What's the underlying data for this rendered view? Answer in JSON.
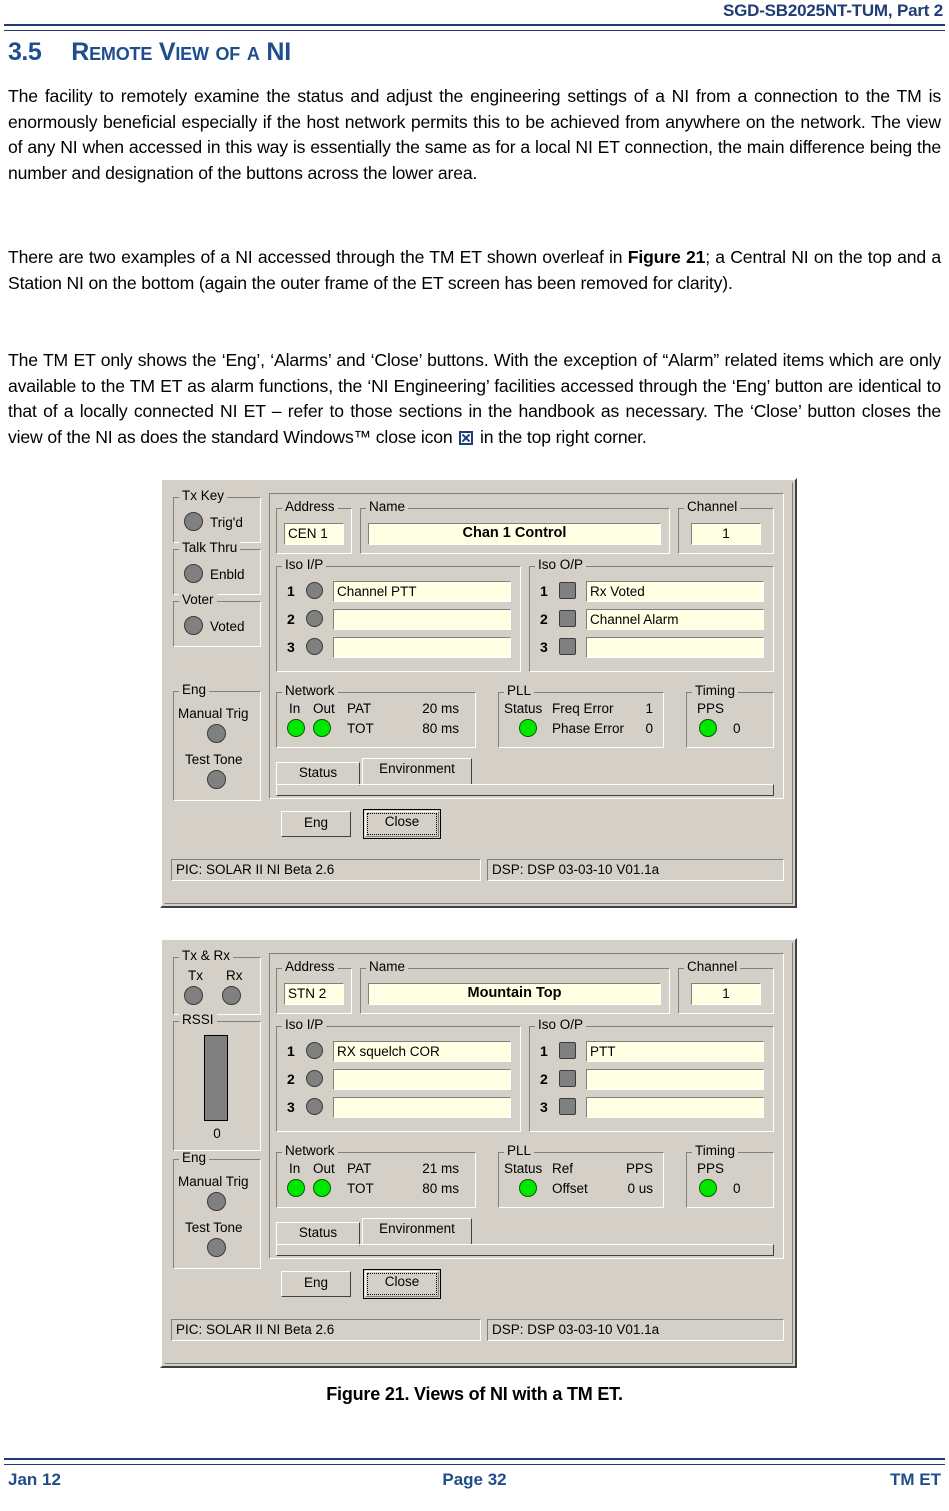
{
  "header": {
    "doc_ref": "SGD-SB2025NT-TUM, Part 2"
  },
  "section": {
    "number": "3.5",
    "title": "Remote View of a NI"
  },
  "paragraphs": {
    "p1": "The facility to remotely examine the status and adjust the engineering settings of a NI from a connection to the TM is enormously beneficial especially if the host network permits this to be achieved from anywhere on the network.  The view of any NI when accessed in this way is essentially the same as for a local NI ET connection, the main difference being the number and designation of the buttons across the lower area.",
    "p2_part1": "There are two examples of a NI accessed through the TM ET shown overleaf in ",
    "p2_bold": "Figure 21",
    "p2_part2": "; a Central NI on the top and a Station NI on the bottom (again the outer frame of the ET screen has been removed for clarity).",
    "p3_part1": "The TM ET only shows the ‘Eng’, ‘Alarms’ and ‘Close’ buttons.  With the exception of “Alarm” related items which are only available to the TM ET as alarm functions, the ‘NI Engineering’ facilities accessed through the ‘Eng’ button are identical to that of a locally connected NI ET – refer to those sections in the handbook as necessary.  The ‘Close’ button closes the view of the NI as does the standard Windows™ close icon ",
    "p3_part2": " in the top right corner.",
    "close_icon_name": "window-close-icon"
  },
  "figure": {
    "caption": "Figure 21.  Views of NI with a TM ET."
  },
  "footer": {
    "left": "Jan 12",
    "center": "Page 32",
    "right": "TM ET"
  },
  "colors": {
    "heading_blue": "#1F4E8C",
    "header_blue": "#1F3C76",
    "dialog_face": "#d4d0c8",
    "field_cream": "#ffffe4",
    "led_on": "#00e800",
    "led_off": "#808080"
  },
  "dialogs": [
    {
      "id": "central-ni",
      "left_groups": {
        "tx_key": {
          "label": "Tx Key",
          "led_label": "Trig'd",
          "led_state": "off"
        },
        "talk_thru": {
          "label": "Talk Thru",
          "led_label": "Enbld",
          "led_state": "off"
        },
        "voter": {
          "label": "Voter",
          "led_label": "Voted",
          "led_state": "off"
        },
        "eng": {
          "label": "Eng",
          "manual_trig_label": "Manual Trig",
          "manual_trig_state": "off",
          "test_tone_label": "Test Tone",
          "test_tone_state": "off"
        }
      },
      "address": {
        "label": "Address",
        "value": "CEN 1"
      },
      "name": {
        "label": "Name",
        "value": "Chan 1 Control"
      },
      "channel": {
        "label": "Channel",
        "value": "1"
      },
      "iso_ip": {
        "label": "Iso I/P",
        "rows": [
          {
            "num": "1",
            "led_state": "off",
            "value": "Channel PTT"
          },
          {
            "num": "2",
            "led_state": "off",
            "value": ""
          },
          {
            "num": "3",
            "led_state": "off",
            "value": ""
          }
        ]
      },
      "iso_op": {
        "label": "Iso O/P",
        "rows": [
          {
            "num": "1",
            "led_state": "off",
            "value": "Rx Voted"
          },
          {
            "num": "2",
            "led_state": "off",
            "value": "Channel Alarm"
          },
          {
            "num": "3",
            "led_state": "off",
            "value": ""
          }
        ]
      },
      "network": {
        "label": "Network",
        "in_label": "In",
        "out_label": "Out",
        "in_state": "on",
        "out_state": "on",
        "pat_label": "PAT",
        "pat_value": "20 ms",
        "tot_label": "TOT",
        "tot_value": "80 ms"
      },
      "pll": {
        "label": "PLL",
        "status_label": "Status",
        "status_state": "on",
        "row1_label": "Freq Error",
        "row1_value": "1",
        "row2_label": "Phase Error",
        "row2_value": "0"
      },
      "timing": {
        "label": "Timing",
        "pps_label": "PPS",
        "pps_state": "on",
        "pps_value": "0"
      },
      "tabs": [
        {
          "label": "Status",
          "active": true
        },
        {
          "label": "Environment",
          "active": false
        }
      ],
      "buttons": [
        {
          "label": "Eng",
          "default": false
        },
        {
          "label": "Close",
          "default": true
        }
      ],
      "status_bar": [
        "PIC: SOLAR II NI Beta 2.6",
        "DSP: DSP 03-03-10 V01.1a"
      ]
    },
    {
      "id": "station-ni",
      "left_groups": {
        "tx_rx": {
          "label": "Tx & Rx",
          "tx_label": "Tx",
          "rx_label": "Rx",
          "tx_state": "off",
          "rx_state": "off"
        },
        "rssi": {
          "label": "RSSI",
          "value": "0",
          "bar_fill_percent": 100
        },
        "eng": {
          "label": "Eng",
          "manual_trig_label": "Manual Trig",
          "manual_trig_state": "off",
          "test_tone_label": "Test Tone",
          "test_tone_state": "off"
        }
      },
      "address": {
        "label": "Address",
        "value": "STN 2"
      },
      "name": {
        "label": "Name",
        "value": "Mountain Top"
      },
      "channel": {
        "label": "Channel",
        "value": "1"
      },
      "iso_ip": {
        "label": "Iso I/P",
        "rows": [
          {
            "num": "1",
            "led_state": "off",
            "value": "RX squelch COR"
          },
          {
            "num": "2",
            "led_state": "off",
            "value": ""
          },
          {
            "num": "3",
            "led_state": "off",
            "value": ""
          }
        ]
      },
      "iso_op": {
        "label": "Iso O/P",
        "rows": [
          {
            "num": "1",
            "led_state": "off",
            "value": "PTT"
          },
          {
            "num": "2",
            "led_state": "off",
            "value": ""
          },
          {
            "num": "3",
            "led_state": "off",
            "value": ""
          }
        ]
      },
      "network": {
        "label": "Network",
        "in_label": "In",
        "out_label": "Out",
        "in_state": "on",
        "out_state": "on",
        "pat_label": "PAT",
        "pat_value": "21 ms",
        "tot_label": "TOT",
        "tot_value": "80 ms"
      },
      "pll": {
        "label": "PLL",
        "status_label": "Status",
        "status_state": "on",
        "row1_label": "Ref",
        "row1_value": "PPS",
        "row2_label": "Offset",
        "row2_value": "0 us"
      },
      "timing": {
        "label": "Timing",
        "pps_label": "PPS",
        "pps_state": "on",
        "pps_value": "0"
      },
      "tabs": [
        {
          "label": "Status",
          "active": true
        },
        {
          "label": "Environment",
          "active": false
        }
      ],
      "buttons": [
        {
          "label": "Eng",
          "default": false
        },
        {
          "label": "Close",
          "default": true
        }
      ],
      "status_bar": [
        "PIC: SOLAR II NI Beta 2.6",
        "DSP: DSP 03-03-10 V01.1a"
      ]
    }
  ]
}
